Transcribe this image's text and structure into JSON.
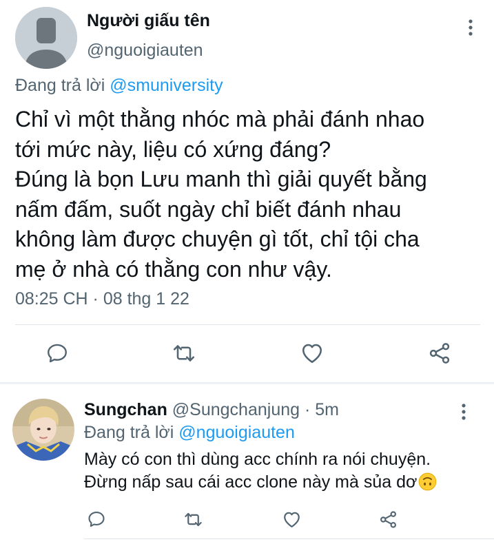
{
  "main_tweet": {
    "display_name": "Người giấu tên",
    "handle": "@nguoigiauten",
    "replying_prefix": "Đang trả lời",
    "replying_to": "@smuniversity",
    "text_lines": [
      "Chỉ vì một thằng nhóc mà phải đánh nhao",
      "tới mức này, liệu có xứng đáng?",
      "Đúng là bọn Lưu manh thì giải quyết bằng",
      "nấm đấm, suốt ngày chỉ biết đánh nhau",
      "không làm được chuyện gì tốt, chỉ tội cha",
      "mẹ ở nhà có thằng con như vậy."
    ],
    "timestamp": "08:25 CH · 08 thg 1 22",
    "actions": [
      "reply-icon",
      "retweet-icon",
      "like-icon",
      "share-icon"
    ]
  },
  "reply_tweet": {
    "display_name": "Sungchan",
    "handle_time": " @Sungchanjung · 5m",
    "replying_prefix": "Đang trả lời",
    "replying_to": "@nguoigiauten",
    "text_lines": [
      "Mày có con thì dùng acc chính ra nói chuyện.",
      "Đừng nấp sau cái acc clone này mà sủa dơ"
    ],
    "emoji": "upside-down-face-emoji",
    "actions": [
      "reply-icon",
      "retweet-icon",
      "like-icon",
      "share-icon"
    ]
  },
  "colors": {
    "text": "#0f1419",
    "secondary": "#536471",
    "link": "#1d9bf0",
    "divider": "#dfe4e8"
  }
}
